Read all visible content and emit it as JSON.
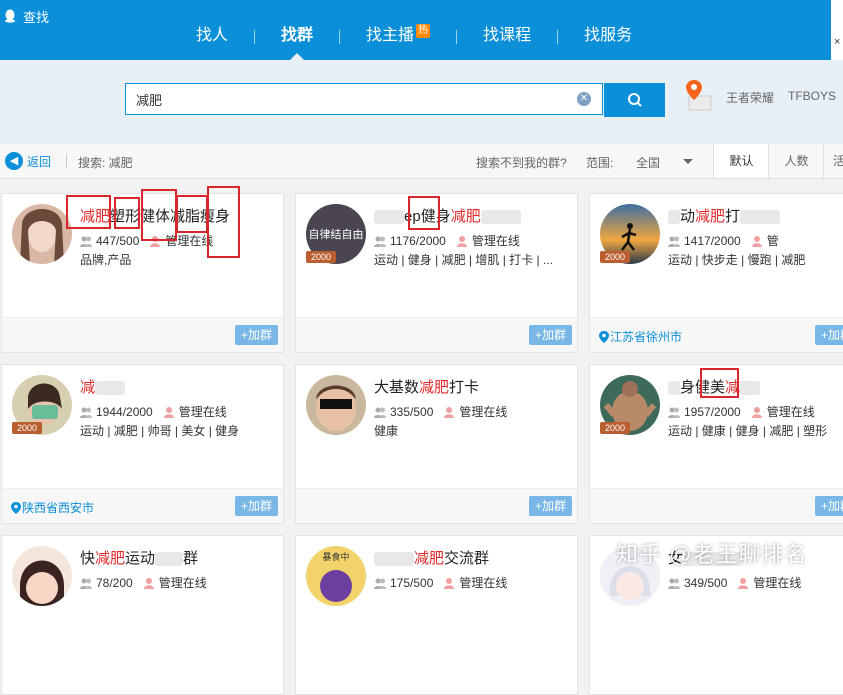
{
  "app": {
    "title": "查找"
  },
  "nav": [
    {
      "label": "找人"
    },
    {
      "label": "找群"
    },
    {
      "label": "找主播",
      "badge": "热"
    },
    {
      "label": "找课程"
    },
    {
      "label": "找服务"
    }
  ],
  "search": {
    "value": "减肥",
    "clear_icon": "clear-icon",
    "button_icon": "search-icon"
  },
  "hot_keywords": [
    "王者荣耀",
    "TFBOYS"
  ],
  "filter": {
    "back": "返回",
    "search_label": "搜索: 减肥",
    "not_found": "搜索不到我的群?",
    "range_label": "范围:",
    "range_value": "全国",
    "sort_default": "默认",
    "sort_members": "人数",
    "sort_more": "活"
  },
  "cards": [
    {
      "name_hl": "减肥",
      "name_rest": "塑形健体减脂瘦身",
      "members": "447/500",
      "admin": "管理在线",
      "tags": "品牌,产品",
      "location": "",
      "add": "+加群"
    },
    {
      "name_pre": "ep",
      "name_mid": "健身",
      "name_hl": "减肥",
      "members": "1176/2000",
      "admin": "管理在线",
      "tags": "运动 | 健身 | 减肥 | 增肌 | 打卡 | ...",
      "location": "",
      "add": "+加群",
      "avatar_text": "自律结自由"
    },
    {
      "name_pre": "动",
      "name_hl": "减肥",
      "name_rest": "打",
      "members": "1417/2000",
      "admin": "管",
      "tags": "运动 | 快步走 | 慢跑 | 减肥",
      "location": "江苏省徐州市",
      "add": "+加群"
    },
    {
      "name_hl": "减",
      "members": "1944/2000",
      "admin": "管理在线",
      "tags": "运动 | 减肥 | 帅哥 | 美女 | 健身",
      "location": "陕西省西安市",
      "add": "+加群"
    },
    {
      "name_pre": "大基数",
      "name_hl": "减肥",
      "name_rest": "打卡",
      "members": "335/500",
      "admin": "管理在线",
      "tags": "健康",
      "location": "",
      "add": "+加群"
    },
    {
      "name_pre": "身",
      "name_mid": "健美",
      "name_hl": "减",
      "members": "1957/2000",
      "admin": "管理在线",
      "tags": "运动 | 健康 | 健身 | 减肥 | 塑形",
      "location": "",
      "add": "+加群"
    },
    {
      "name_pre": "快",
      "name_hl": "减肥",
      "name_rest": "运动",
      "name_tail": "群",
      "members": "78/200",
      "admin": "管理在线"
    },
    {
      "name_hl": "减肥",
      "name_rest": "交流群",
      "members": "175/500",
      "admin": "管理在线",
      "avatar_text": "暴食中"
    },
    {
      "name_pre": "女",
      "members": "349/500",
      "admin": "管理在线"
    }
  ],
  "badge_2000": "2000",
  "watermark": "知乎 @老王聊排名"
}
